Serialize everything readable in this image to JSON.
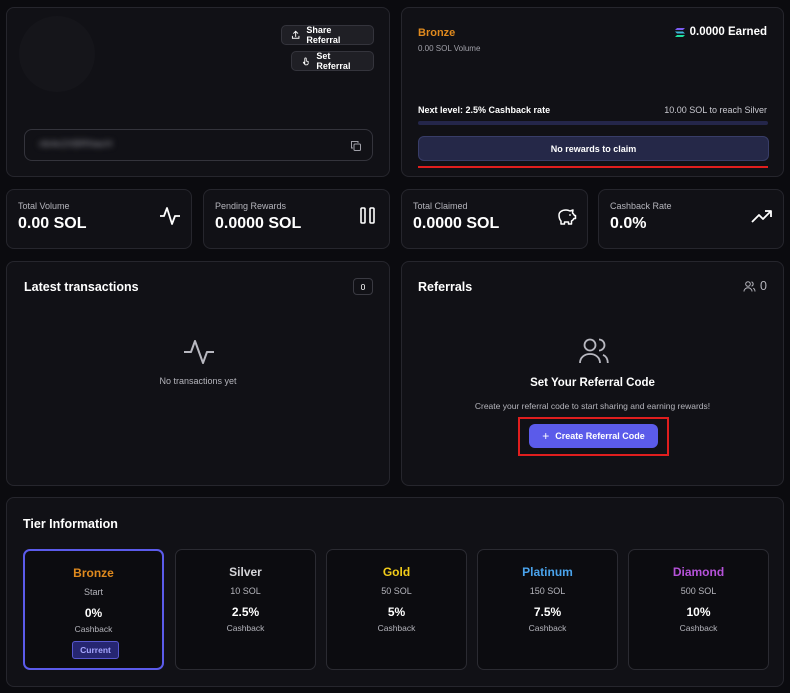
{
  "profile": {
    "share_referral_label": "Share Referral",
    "set_referral_label": "Set Referral",
    "wallet_address": "nb4e2XBRNacH"
  },
  "tier_progress": {
    "tier_name": "Bronze",
    "volume": "0.00 SOL Volume",
    "earned": "0.0000 Earned",
    "next_level": "Next level: 2.5% Cashback rate",
    "to_reach": "10.00 SOL to reach Silver",
    "progress_fraction": 0,
    "claim_label": "No rewards to claim"
  },
  "stats": [
    {
      "label": "Total Volume",
      "value": "0.00 SOL",
      "icon": "activity-icon"
    },
    {
      "label": "Pending Rewards",
      "value": "0.0000 SOL",
      "icon": "pause-icon"
    },
    {
      "label": "Total Claimed",
      "value": "0.0000 SOL",
      "icon": "piggy-bank-icon"
    },
    {
      "label": "Cashback Rate",
      "value": "0.0%",
      "icon": "trending-up-icon"
    }
  ],
  "transactions": {
    "title": "Latest transactions",
    "count": "0",
    "empty_text": "No transactions yet"
  },
  "referrals": {
    "title": "Referrals",
    "count": "0",
    "heading": "Set Your Referral Code",
    "description": "Create your referral code to start sharing and earning rewards!",
    "button_label": "Create Referral Code"
  },
  "tiers": {
    "title": "Tier Information",
    "items": [
      {
        "name": "Bronze",
        "volume": "Start",
        "rate": "0%",
        "cashback": "Cashback",
        "color": "#e08a1e",
        "badge": "Current"
      },
      {
        "name": "Silver",
        "volume": "10 SOL",
        "rate": "2.5%",
        "cashback": "Cashback",
        "color": "#d4d4d8"
      },
      {
        "name": "Gold",
        "volume": "50 SOL",
        "rate": "5%",
        "cashback": "Cashback",
        "color": "#f2cc1a"
      },
      {
        "name": "Platinum",
        "volume": "150 SOL",
        "rate": "7.5%",
        "cashback": "Cashback",
        "color": "#4aa3ec"
      },
      {
        "name": "Diamond",
        "volume": "500 SOL",
        "rate": "10%",
        "cashback": "Cashback",
        "color": "#b552d9"
      }
    ]
  },
  "colors": {
    "accent": "#5b5bea",
    "highlight_red": "#e01e1e",
    "bronze": "#e08a1e"
  }
}
